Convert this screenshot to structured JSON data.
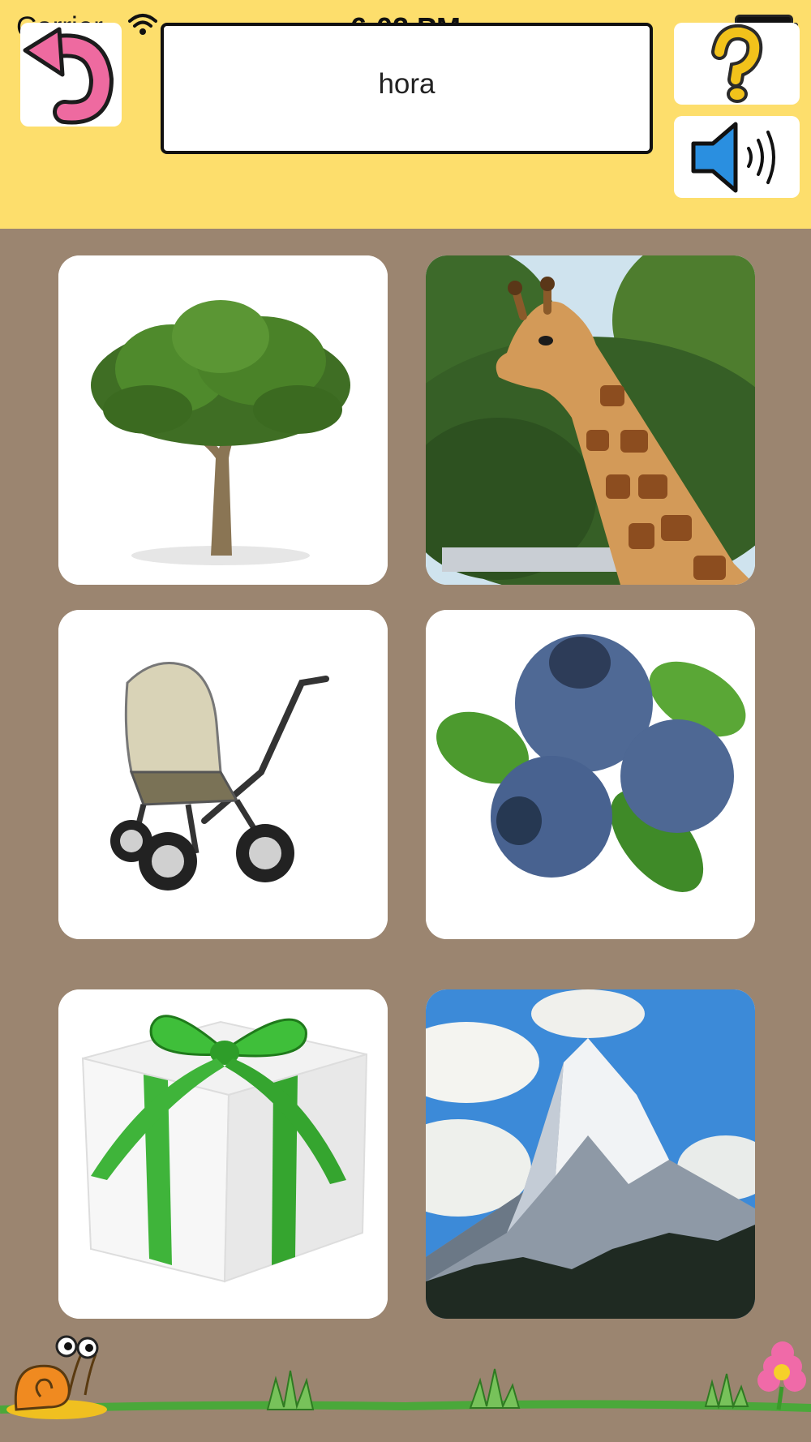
{
  "status_bar": {
    "carrier": "Carrier",
    "time": "6:02 PM"
  },
  "header": {
    "word": "hora",
    "back_icon": "undo-arrow-icon",
    "help_icon": "question-mark-icon",
    "sound_icon": "speaker-icon"
  },
  "choices": [
    {
      "picture": "tree"
    },
    {
      "picture": "giraffe"
    },
    {
      "picture": "baby-stroller"
    },
    {
      "picture": "blueberries"
    },
    {
      "picture": "gift-box"
    },
    {
      "picture": "mountain"
    }
  ],
  "colors": {
    "header_bg": "#fdde6c",
    "page_bg": "#9b8570",
    "card_bg": "#ffffff",
    "back_arrow": "#ee6aa0",
    "help_mark": "#f2c21b",
    "speaker": "#2a8fe0"
  }
}
